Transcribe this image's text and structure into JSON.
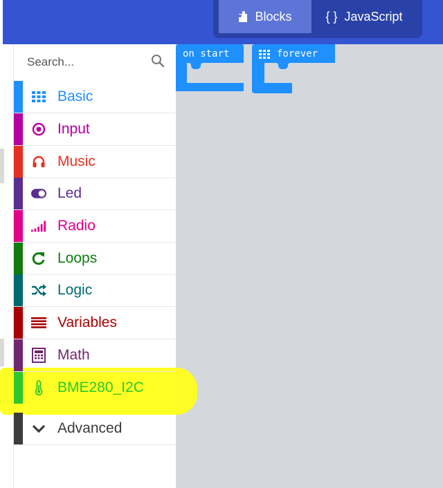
{
  "header": {
    "modes": [
      {
        "label": "Blocks",
        "icon": "puzzle-icon",
        "active": true
      },
      {
        "label": "JavaScript",
        "icon": "braces-icon",
        "active": false
      }
    ],
    "js_braces": "{ }"
  },
  "search": {
    "placeholder": "Search..."
  },
  "categories": [
    {
      "label": "Basic",
      "icon": "grid-icon",
      "color": "#1e90ff",
      "text_color": "#1e90ff"
    },
    {
      "label": "Input",
      "icon": "target-icon",
      "color": "#b4009e",
      "text_color": "#b4009e"
    },
    {
      "label": "Music",
      "icon": "headphones-icon",
      "color": "#e63022",
      "text_color": "#e63022"
    },
    {
      "label": "Led",
      "icon": "toggle-icon",
      "color": "#5c2d91",
      "text_color": "#5c2d91"
    },
    {
      "label": "Radio",
      "icon": "signal-bars-icon",
      "color": "#e3008c",
      "text_color": "#e3008c"
    },
    {
      "label": "Loops",
      "icon": "refresh-icon",
      "color": "#107c10",
      "text_color": "#107c10"
    },
    {
      "label": "Logic",
      "icon": "shuffle-icon",
      "color": "#006970",
      "text_color": "#006970"
    },
    {
      "label": "Variables",
      "icon": "lines-icon",
      "color": "#a80000",
      "text_color": "#a80000"
    },
    {
      "label": "Math",
      "icon": "calculator-icon",
      "color": "#712672",
      "text_color": "#712672"
    },
    {
      "label": "BME280_I2C",
      "icon": "thermometer-icon",
      "color": "#2dc82d",
      "text_color": "#2dc82d",
      "highlighted": true
    },
    {
      "label": "Advanced",
      "icon": "chevron-down-icon",
      "color": "#3c3c3c",
      "text_color": "#3c3c3c"
    }
  ],
  "workspace": {
    "blocks": [
      {
        "label": "on start",
        "color": "#1e90ff"
      },
      {
        "label": "forever",
        "color": "#1e90ff",
        "icon": "grid-icon"
      }
    ]
  }
}
